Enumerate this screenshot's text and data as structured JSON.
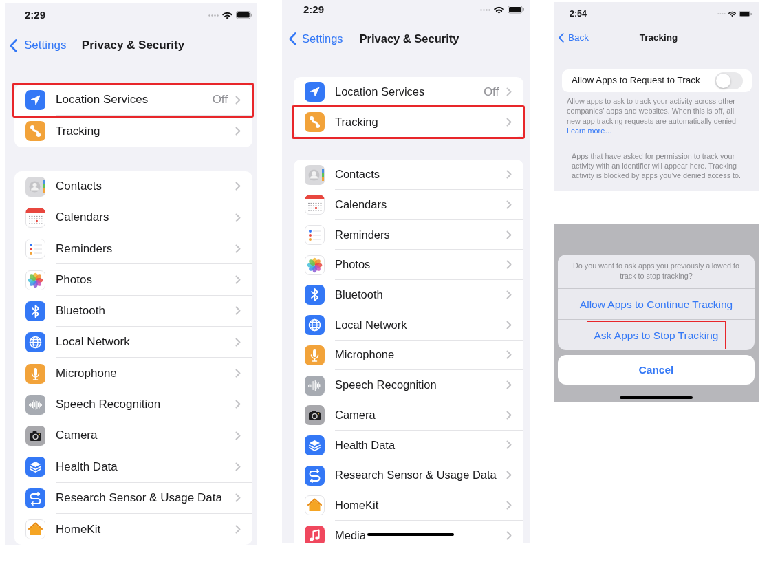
{
  "screens": [
    {
      "kind": "settings_list",
      "status_bar": {
        "time": "2:29"
      },
      "nav": {
        "back": "Settings",
        "title": "Privacy & Security"
      },
      "groups": [
        {
          "rows": [
            {
              "label": "Location Services",
              "value": "Off",
              "highlighted": true
            },
            {
              "label": "Tracking",
              "highlighted": false
            }
          ]
        },
        {
          "rows": [
            {
              "label": "Contacts",
              "highlighted": false
            },
            {
              "label": "Calendars",
              "highlighted": false
            },
            {
              "label": "Reminders",
              "highlighted": false
            },
            {
              "label": "Photos",
              "highlighted": false
            },
            {
              "label": "Bluetooth",
              "highlighted": false
            },
            {
              "label": "Local Network",
              "highlighted": false
            },
            {
              "label": "Microphone",
              "highlighted": false
            },
            {
              "label": "Speech Recognition",
              "highlighted": false
            },
            {
              "label": "Camera",
              "highlighted": false
            },
            {
              "label": "Health Data",
              "highlighted": false
            },
            {
              "label": "Research Sensor & Usage Data",
              "highlighted": false
            },
            {
              "label": "HomeKit",
              "highlighted": false
            }
          ]
        }
      ]
    },
    {
      "kind": "settings_list",
      "status_bar": {
        "time": "2:29"
      },
      "nav": {
        "back": "Settings",
        "title": "Privacy & Security"
      },
      "groups": [
        {
          "rows": [
            {
              "label": "Location Services",
              "value": "Off",
              "highlighted": false
            },
            {
              "label": "Tracking",
              "highlighted": true
            }
          ]
        },
        {
          "rows": [
            {
              "label": "Contacts",
              "highlighted": false
            },
            {
              "label": "Calendars",
              "highlighted": false
            },
            {
              "label": "Reminders",
              "highlighted": false
            },
            {
              "label": "Photos",
              "highlighted": false
            },
            {
              "label": "Bluetooth",
              "highlighted": false
            },
            {
              "label": "Local Network",
              "highlighted": false
            },
            {
              "label": "Microphone",
              "highlighted": false
            },
            {
              "label": "Speech Recognition",
              "highlighted": false
            },
            {
              "label": "Camera",
              "highlighted": false
            },
            {
              "label": "Health Data",
              "highlighted": false
            },
            {
              "label": "Research Sensor & Usage Data",
              "highlighted": false
            },
            {
              "label": "HomeKit",
              "highlighted": false
            },
            {
              "label": "Media",
              "highlighted": false
            }
          ]
        }
      ]
    },
    {
      "kind": "tracking_settings",
      "status_bar": {
        "time": "2:54"
      },
      "nav": {
        "back": "Back",
        "title": "Tracking"
      },
      "toggle": {
        "label": "Allow Apps to Request to Track",
        "on": false
      },
      "footer": "Allow apps to ask to track your activity across other companies’ apps and websites. When this is off, all new app tracking requests are automatically denied.",
      "learn_more": "Learn more…",
      "note": "Apps that have asked for permission to track your activity with an identifier will appear here. Tracking activity is blocked by apps you’ve denied access to."
    },
    {
      "kind": "action_sheet",
      "message": "Do you want to ask apps you previously allowed to track to stop tracking?",
      "actions": [
        {
          "label": "Allow Apps to Continue Tracking",
          "highlighted": false
        },
        {
          "label": "Ask Apps to Stop Tracking",
          "highlighted": true
        }
      ],
      "cancel": "Cancel"
    }
  ]
}
